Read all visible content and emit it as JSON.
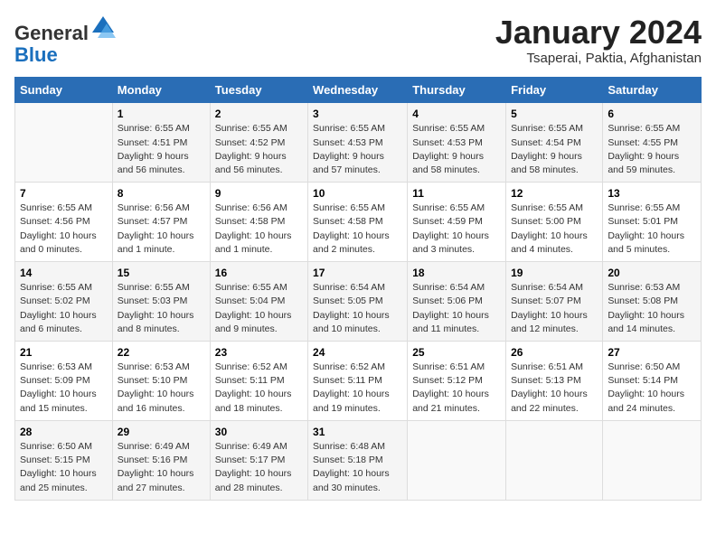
{
  "header": {
    "logo_general": "General",
    "logo_blue": "Blue",
    "month_title": "January 2024",
    "subtitle": "Tsaperai, Paktia, Afghanistan"
  },
  "columns": [
    "Sunday",
    "Monday",
    "Tuesday",
    "Wednesday",
    "Thursday",
    "Friday",
    "Saturday"
  ],
  "weeks": [
    [
      {
        "num": "",
        "detail": ""
      },
      {
        "num": "1",
        "detail": "Sunrise: 6:55 AM\nSunset: 4:51 PM\nDaylight: 9 hours\nand 56 minutes."
      },
      {
        "num": "2",
        "detail": "Sunrise: 6:55 AM\nSunset: 4:52 PM\nDaylight: 9 hours\nand 56 minutes."
      },
      {
        "num": "3",
        "detail": "Sunrise: 6:55 AM\nSunset: 4:53 PM\nDaylight: 9 hours\nand 57 minutes."
      },
      {
        "num": "4",
        "detail": "Sunrise: 6:55 AM\nSunset: 4:53 PM\nDaylight: 9 hours\nand 58 minutes."
      },
      {
        "num": "5",
        "detail": "Sunrise: 6:55 AM\nSunset: 4:54 PM\nDaylight: 9 hours\nand 58 minutes."
      },
      {
        "num": "6",
        "detail": "Sunrise: 6:55 AM\nSunset: 4:55 PM\nDaylight: 9 hours\nand 59 minutes."
      }
    ],
    [
      {
        "num": "7",
        "detail": "Sunrise: 6:55 AM\nSunset: 4:56 PM\nDaylight: 10 hours\nand 0 minutes."
      },
      {
        "num": "8",
        "detail": "Sunrise: 6:56 AM\nSunset: 4:57 PM\nDaylight: 10 hours\nand 1 minute."
      },
      {
        "num": "9",
        "detail": "Sunrise: 6:56 AM\nSunset: 4:58 PM\nDaylight: 10 hours\nand 1 minute."
      },
      {
        "num": "10",
        "detail": "Sunrise: 6:55 AM\nSunset: 4:58 PM\nDaylight: 10 hours\nand 2 minutes."
      },
      {
        "num": "11",
        "detail": "Sunrise: 6:55 AM\nSunset: 4:59 PM\nDaylight: 10 hours\nand 3 minutes."
      },
      {
        "num": "12",
        "detail": "Sunrise: 6:55 AM\nSunset: 5:00 PM\nDaylight: 10 hours\nand 4 minutes."
      },
      {
        "num": "13",
        "detail": "Sunrise: 6:55 AM\nSunset: 5:01 PM\nDaylight: 10 hours\nand 5 minutes."
      }
    ],
    [
      {
        "num": "14",
        "detail": "Sunrise: 6:55 AM\nSunset: 5:02 PM\nDaylight: 10 hours\nand 6 minutes."
      },
      {
        "num": "15",
        "detail": "Sunrise: 6:55 AM\nSunset: 5:03 PM\nDaylight: 10 hours\nand 8 minutes."
      },
      {
        "num": "16",
        "detail": "Sunrise: 6:55 AM\nSunset: 5:04 PM\nDaylight: 10 hours\nand 9 minutes."
      },
      {
        "num": "17",
        "detail": "Sunrise: 6:54 AM\nSunset: 5:05 PM\nDaylight: 10 hours\nand 10 minutes."
      },
      {
        "num": "18",
        "detail": "Sunrise: 6:54 AM\nSunset: 5:06 PM\nDaylight: 10 hours\nand 11 minutes."
      },
      {
        "num": "19",
        "detail": "Sunrise: 6:54 AM\nSunset: 5:07 PM\nDaylight: 10 hours\nand 12 minutes."
      },
      {
        "num": "20",
        "detail": "Sunrise: 6:53 AM\nSunset: 5:08 PM\nDaylight: 10 hours\nand 14 minutes."
      }
    ],
    [
      {
        "num": "21",
        "detail": "Sunrise: 6:53 AM\nSunset: 5:09 PM\nDaylight: 10 hours\nand 15 minutes."
      },
      {
        "num": "22",
        "detail": "Sunrise: 6:53 AM\nSunset: 5:10 PM\nDaylight: 10 hours\nand 16 minutes."
      },
      {
        "num": "23",
        "detail": "Sunrise: 6:52 AM\nSunset: 5:11 PM\nDaylight: 10 hours\nand 18 minutes."
      },
      {
        "num": "24",
        "detail": "Sunrise: 6:52 AM\nSunset: 5:11 PM\nDaylight: 10 hours\nand 19 minutes."
      },
      {
        "num": "25",
        "detail": "Sunrise: 6:51 AM\nSunset: 5:12 PM\nDaylight: 10 hours\nand 21 minutes."
      },
      {
        "num": "26",
        "detail": "Sunrise: 6:51 AM\nSunset: 5:13 PM\nDaylight: 10 hours\nand 22 minutes."
      },
      {
        "num": "27",
        "detail": "Sunrise: 6:50 AM\nSunset: 5:14 PM\nDaylight: 10 hours\nand 24 minutes."
      }
    ],
    [
      {
        "num": "28",
        "detail": "Sunrise: 6:50 AM\nSunset: 5:15 PM\nDaylight: 10 hours\nand 25 minutes."
      },
      {
        "num": "29",
        "detail": "Sunrise: 6:49 AM\nSunset: 5:16 PM\nDaylight: 10 hours\nand 27 minutes."
      },
      {
        "num": "30",
        "detail": "Sunrise: 6:49 AM\nSunset: 5:17 PM\nDaylight: 10 hours\nand 28 minutes."
      },
      {
        "num": "31",
        "detail": "Sunrise: 6:48 AM\nSunset: 5:18 PM\nDaylight: 10 hours\nand 30 minutes."
      },
      {
        "num": "",
        "detail": ""
      },
      {
        "num": "",
        "detail": ""
      },
      {
        "num": "",
        "detail": ""
      }
    ]
  ]
}
